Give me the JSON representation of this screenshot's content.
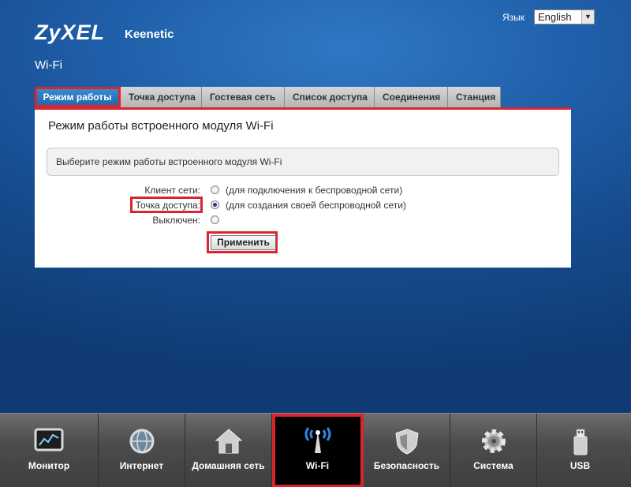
{
  "header": {
    "logo": "ZyXEL",
    "product": "Keenetic",
    "section": "Wi-Fi",
    "language_label": "Язык",
    "language_value": "English"
  },
  "tabs": [
    {
      "label": "Режим работы",
      "active": true
    },
    {
      "label": "Точка доступа",
      "active": false
    },
    {
      "label": "Гостевая сеть",
      "active": false
    },
    {
      "label": "Список доступа",
      "active": false
    },
    {
      "label": "Соединения",
      "active": false
    },
    {
      "label": "Станция",
      "active": false
    }
  ],
  "panel": {
    "title": "Режим работы встроенного модуля Wi-Fi",
    "hint": "Выберите режим работы встроенного модуля Wi-Fi",
    "options": [
      {
        "label": "Клиент сети:",
        "description": "(для подключения к беспроводной сети)",
        "checked": false
      },
      {
        "label": "Точка доступа:",
        "description": "(для создания своей беспроводной сети)",
        "checked": true
      },
      {
        "label": "Выключен:",
        "description": "",
        "checked": false
      }
    ],
    "apply_label": "Применить"
  },
  "nav": [
    {
      "label": "Монитор",
      "icon": "monitor-icon",
      "active": false
    },
    {
      "label": "Интернет",
      "icon": "globe-icon",
      "active": false
    },
    {
      "label": "Домашняя сеть",
      "icon": "home-icon",
      "active": false
    },
    {
      "label": "Wi-Fi",
      "icon": "wifi-antenna-icon",
      "active": true
    },
    {
      "label": "Безопасность",
      "icon": "shield-icon",
      "active": false
    },
    {
      "label": "Система",
      "icon": "gear-icon",
      "active": false
    },
    {
      "label": "USB",
      "icon": "usb-icon",
      "active": false
    }
  ],
  "colors": {
    "highlight": "#d9252e",
    "active_tab": "#1c64ab",
    "background": "#1f5ea8"
  }
}
